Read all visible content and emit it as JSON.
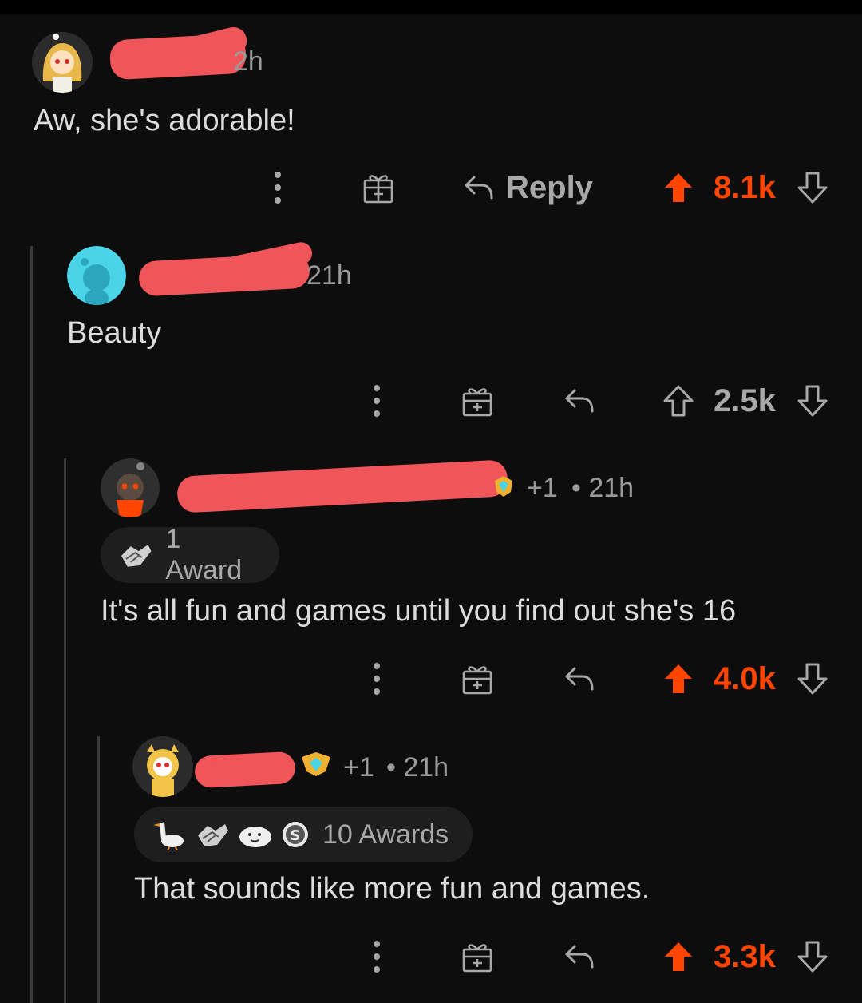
{
  "colors": {
    "upvote": "#ff4500",
    "muted": "#a8a8a8",
    "redaction": "#f0555a",
    "background": "#0d0d0d"
  },
  "comments": [
    {
      "time": "2h",
      "body": "Aw, she's adorable!",
      "reply_label": "Reply",
      "score": "8.1k",
      "upvoted": true
    },
    {
      "time": "21h",
      "body": "Beauty",
      "score": "2.5k",
      "upvoted": false
    },
    {
      "flair_plus": "+1",
      "time": "• 21h",
      "awards": "1 Award",
      "body": "It's all fun and games until you find out she's 16",
      "score": "4.0k",
      "upvoted": true
    },
    {
      "flair_plus": "+1",
      "time": "• 21h",
      "awards": "10 Awards",
      "body": "That sounds like more fun and games.",
      "score": "3.3k",
      "upvoted": true
    }
  ],
  "icons": {
    "more": "more-vert-icon",
    "gift": "gift-icon",
    "reply": "reply-arrow-icon",
    "upvote": "upvote-arrow-icon",
    "downvote": "downvote-arrow-icon"
  }
}
